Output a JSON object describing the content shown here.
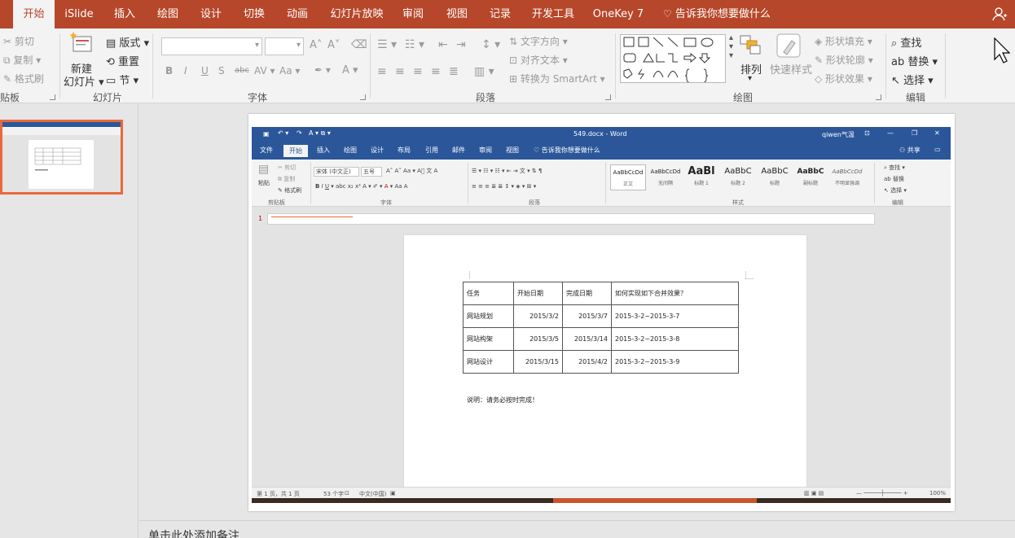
{
  "ppt": {
    "tabs": [
      "开始",
      "iSlide",
      "插入",
      "绘图",
      "设计",
      "切换",
      "动画",
      "幻灯片放映",
      "审阅",
      "视图",
      "记录",
      "开发工具",
      "OneKey 7"
    ],
    "tell_me": "告诉我你想要做什么",
    "clipboard": {
      "cut": "剪切",
      "copy": "复制",
      "format_painter": "格式刷",
      "label": "贴板"
    },
    "slides": {
      "new_slide": "新建",
      "new_slide2": "幻灯片",
      "layout": "版式",
      "reset": "重置",
      "section": "节",
      "label": "幻灯片"
    },
    "font": {
      "label": "字体",
      "bold": "B",
      "italic": "I",
      "underline": "U",
      "strike": "abc",
      "aa": "Aa"
    },
    "paragraph": {
      "text_direction": "文字方向",
      "align_text": "对齐文本",
      "convert_smartart": "转换为 SmartArt",
      "label": "段落"
    },
    "drawing": {
      "arrange": "排列",
      "quick_styles": "快速样式",
      "shape_fill": "形状填充",
      "shape_outline": "形状轮廓",
      "shape_effects": "形状效果",
      "label": "绘图"
    },
    "editing": {
      "find": "查找",
      "replace": "替换",
      "select": "选择",
      "label": "编辑"
    },
    "slide_number": "1",
    "notes_placeholder": "单击此处添加备注"
  },
  "word": {
    "title": "549.docx - Word",
    "user": "qiwen气温",
    "tabs": [
      "文件",
      "开始",
      "插入",
      "绘图",
      "设计",
      "布局",
      "引用",
      "邮件",
      "审阅",
      "视图"
    ],
    "tell_me": "告诉我你想要做什么",
    "share": "共享",
    "clipboard": {
      "paste": "粘贴",
      "cut": "剪切",
      "copy": "复制",
      "format_painter": "格式刷",
      "label": "剪贴板"
    },
    "font": {
      "name": "宋体 (中文正)",
      "size": "五号",
      "label": "字体"
    },
    "paragraph_label": "段落",
    "styles_label": "样式",
    "styles": [
      {
        "preview": "AaBbCcDd",
        "name": "正文"
      },
      {
        "preview": "AaBbCcDd",
        "name": "无间隔"
      },
      {
        "preview": "AaBl",
        "name": "标题 1"
      },
      {
        "preview": "AaBbC",
        "name": "标题 2"
      },
      {
        "preview": "AaBbC",
        "name": "标题"
      },
      {
        "preview": "AaBbC",
        "name": "副标题"
      },
      {
        "preview": "AaBbCcDd",
        "name": "不明显强调"
      }
    ],
    "editing": {
      "find": "查找",
      "replace": "替换",
      "select": "选择",
      "label": "编辑"
    },
    "ruler_number": "1",
    "table": {
      "headers": [
        "任务",
        "开始日期",
        "完成日期",
        "如何实现如下合并效果？"
      ],
      "rows": [
        [
          "网站规划",
          "2015/3/2",
          "2015/3/7",
          "2015-3-2~2015-3-7"
        ],
        [
          "网站构架",
          "2015/3/5",
          "2015/3/14",
          "2015-3-2~2015-3-8"
        ],
        [
          "网站设计",
          "2015/3/15",
          "2015/4/2",
          "2015-3-2~2015-3-9"
        ]
      ]
    },
    "note": "说明：请务必按时完成！",
    "status": {
      "page": "第 1 页，共 1 页",
      "words": "53 个字",
      "lang": "中文(中国)",
      "zoom": "100%"
    }
  }
}
